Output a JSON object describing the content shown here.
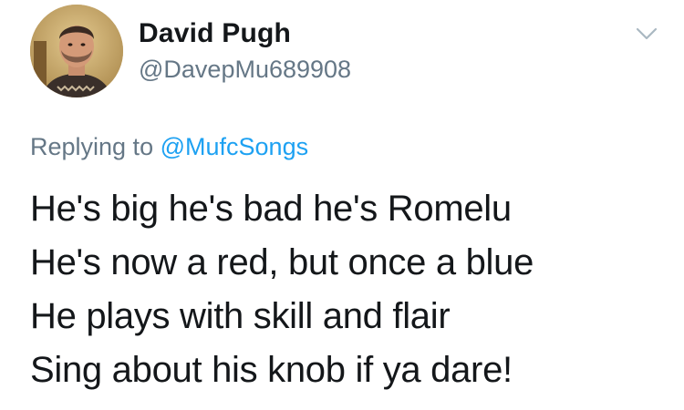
{
  "author": {
    "display_name": "David Pugh",
    "handle": "@DavepMu689908",
    "avatar_icon": "profile-photo"
  },
  "menu": {
    "icon": "chevron-down-icon",
    "color": "#aab8c2"
  },
  "reply_context": {
    "prefix": "Replying to",
    "mention": "@MufcSongs"
  },
  "tweet": {
    "lines": [
      "He's big he's bad he's Romelu",
      "He's now a red, but once a blue",
      "He plays with skill and flair",
      "Sing about his knob if ya dare!"
    ]
  },
  "colors": {
    "text": "#14171a",
    "secondary": "#657786",
    "link": "#1da1f2",
    "background": "#ffffff"
  }
}
